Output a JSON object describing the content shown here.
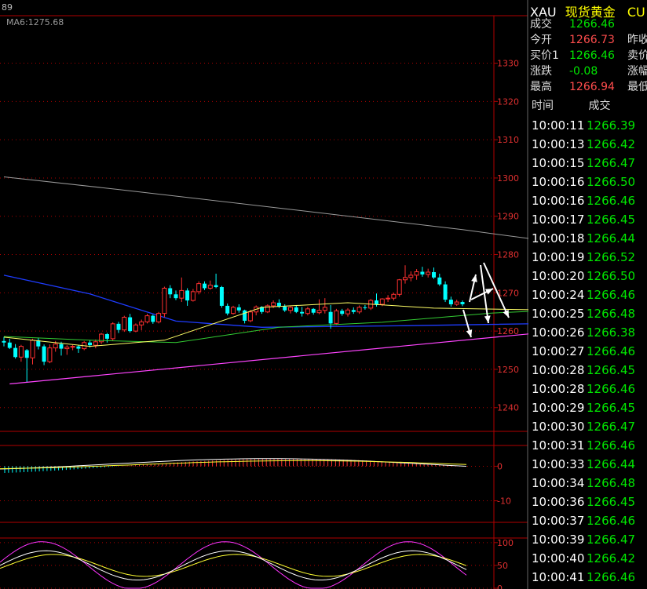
{
  "header": {
    "left_label": "89",
    "ma_label": "MA6:1275.68"
  },
  "colors": {
    "up": "#ff3030",
    "down": "#00ffff",
    "axis": "#b00000",
    "ma_gray": "#9a9a9a",
    "ma_yellow": "#ffff66",
    "ma_green": "#33cc33",
    "ma_blue": "#1e3cff",
    "trend_magenta": "#ff44ff",
    "arrow": "#ffffff"
  },
  "chart_data": [
    {
      "type": "candlestick",
      "yaxis": {
        "ticks": [
          "1330",
          "1320",
          "1310",
          "1300",
          "1290",
          "1280",
          "1270",
          "1260",
          "1250",
          "1240"
        ],
        "tick_values": [
          1330,
          1320,
          1310,
          1300,
          1290,
          1280,
          1270,
          1260,
          1250,
          1240
        ],
        "ylim": [
          1234,
          1342
        ]
      },
      "candles": [
        [
          1257.4,
          1258.5,
          1256.0,
          1257.0
        ],
        [
          1257.0,
          1258.0,
          1255.3,
          1255.6
        ],
        [
          1255.6,
          1256.6,
          1252.8,
          1253.2
        ],
        [
          1253.2,
          1256.4,
          1252.0,
          1256.0
        ],
        [
          1255.0,
          1255.3,
          1246.5,
          1253.0
        ],
        [
          1253.0,
          1258.0,
          1251.3,
          1257.6
        ],
        [
          1257.6,
          1258.3,
          1255.2,
          1256.0
        ],
        [
          1256.0,
          1256.5,
          1251.1,
          1252.0
        ],
        [
          1252.0,
          1256.5,
          1251.6,
          1255.6
        ],
        [
          1255.6,
          1257.4,
          1254.6,
          1256.6
        ],
        [
          1256.6,
          1257.2,
          1253.6,
          1255.4
        ],
        [
          1255.4,
          1256.3,
          1253.8,
          1255.8
        ],
        [
          1255.8,
          1256.4,
          1255.0,
          1256.0
        ],
        [
          1256.0,
          1256.4,
          1254.3,
          1255.4
        ],
        [
          1255.4,
          1257.4,
          1255.0,
          1257.0
        ],
        [
          1257.0,
          1257.6,
          1255.7,
          1256.3
        ],
        [
          1256.3,
          1257.8,
          1255.5,
          1257.2
        ],
        [
          1257.2,
          1259.5,
          1256.6,
          1259.2
        ],
        [
          1259.2,
          1259.5,
          1257.0,
          1258.0
        ],
        [
          1258.0,
          1262.3,
          1257.5,
          1261.9
        ],
        [
          1261.9,
          1262.4,
          1259.5,
          1260.3
        ],
        [
          1260.3,
          1264.0,
          1259.8,
          1263.6
        ],
        [
          1263.6,
          1264.5,
          1259.6,
          1260.0
        ],
        [
          1260.0,
          1262.0,
          1259.7,
          1261.6
        ],
        [
          1261.6,
          1263.0,
          1260.2,
          1262.4
        ],
        [
          1262.4,
          1264.5,
          1262.0,
          1264.0
        ],
        [
          1264.0,
          1264.3,
          1261.9,
          1262.4
        ],
        [
          1262.4,
          1265.0,
          1262.0,
          1264.6
        ],
        [
          1264.6,
          1271.6,
          1263.6,
          1271.2
        ],
        [
          1271.2,
          1272.0,
          1268.6,
          1269.6
        ],
        [
          1269.6,
          1270.6,
          1268.1,
          1268.6
        ],
        [
          1268.6,
          1274.0,
          1267.6,
          1270.6
        ],
        [
          1270.6,
          1271.2,
          1266.6,
          1268.0
        ],
        [
          1268.0,
          1271.0,
          1267.7,
          1270.3
        ],
        [
          1270.3,
          1273.0,
          1269.6,
          1272.4
        ],
        [
          1272.4,
          1273.0,
          1270.7,
          1271.2
        ],
        [
          1271.2,
          1273.2,
          1270.8,
          1272.0
        ],
        [
          1272.0,
          1275.0,
          1271.2,
          1271.5
        ],
        [
          1271.5,
          1271.8,
          1266.1,
          1266.6
        ],
        [
          1266.6,
          1267.2,
          1264.1,
          1264.6
        ],
        [
          1264.6,
          1266.6,
          1264.3,
          1266.2
        ],
        [
          1266.2,
          1267.0,
          1264.8,
          1265.4
        ],
        [
          1265.4,
          1265.6,
          1262.0,
          1262.7
        ],
        [
          1262.7,
          1265.5,
          1262.3,
          1265.0
        ],
        [
          1265.0,
          1266.7,
          1264.1,
          1266.3
        ],
        [
          1266.3,
          1266.5,
          1264.5,
          1265.0
        ],
        [
          1265.0,
          1267.0,
          1264.7,
          1266.6
        ],
        [
          1266.6,
          1268.0,
          1266.0,
          1267.4
        ],
        [
          1267.4,
          1268.3,
          1266.0,
          1266.4
        ],
        [
          1266.4,
          1267.0,
          1265.0,
          1265.4
        ],
        [
          1265.4,
          1266.5,
          1264.6,
          1266.2
        ],
        [
          1266.2,
          1266.8,
          1264.7,
          1265.0
        ],
        [
          1265.0,
          1266.3,
          1263.8,
          1264.6
        ],
        [
          1264.6,
          1266.3,
          1264.1,
          1265.8
        ],
        [
          1265.8,
          1266.0,
          1264.3,
          1264.8
        ],
        [
          1264.8,
          1268.3,
          1264.4,
          1265.4
        ],
        [
          1265.4,
          1268.6,
          1264.6,
          1266.2
        ],
        [
          1265.0,
          1266.8,
          1260.6,
          1262.0
        ],
        [
          1262.0,
          1265.8,
          1261.6,
          1265.3
        ],
        [
          1265.3,
          1265.8,
          1264.0,
          1264.5
        ],
        [
          1264.5,
          1266.0,
          1263.8,
          1265.5
        ],
        [
          1265.5,
          1266.2,
          1264.5,
          1265.0
        ],
        [
          1265.0,
          1266.7,
          1264.5,
          1266.2
        ],
        [
          1266.2,
          1266.8,
          1265.6,
          1266.0
        ],
        [
          1266.0,
          1268.4,
          1265.5,
          1268.0
        ],
        [
          1268.0,
          1269.8,
          1266.4,
          1267.0
        ],
        [
          1267.0,
          1268.6,
          1266.5,
          1268.4
        ],
        [
          1268.4,
          1269.4,
          1267.6,
          1268.6
        ],
        [
          1268.6,
          1270.0,
          1268.0,
          1269.6
        ],
        [
          1269.6,
          1273.6,
          1269.0,
          1273.4
        ],
        [
          1273.4,
          1277.2,
          1272.4,
          1274.0
        ],
        [
          1274.0,
          1275.6,
          1273.0,
          1274.6
        ],
        [
          1274.6,
          1276.2,
          1273.4,
          1275.5
        ],
        [
          1275.5,
          1276.8,
          1274.2,
          1274.8
        ],
        [
          1274.8,
          1276.3,
          1274.0,
          1275.4
        ],
        [
          1275.4,
          1276.6,
          1273.6,
          1274.0
        ],
        [
          1274.0,
          1275.0,
          1271.8,
          1272.2
        ],
        [
          1272.2,
          1273.0,
          1267.6,
          1268.2
        ],
        [
          1268.2,
          1269.0,
          1266.4,
          1267.0
        ],
        [
          1267.0,
          1268.2,
          1266.6,
          1267.6
        ],
        [
          1267.6,
          1268.0,
          1266.5,
          1267.0
        ]
      ],
      "ma_gray": [
        [
          0,
          1300.3
        ],
        [
          20,
          1297.0
        ],
        [
          50,
          1291.8
        ],
        [
          80,
          1286.5
        ],
        [
          110,
          1280.5
        ],
        [
          125,
          1276.0
        ],
        [
          140,
          1273.4
        ],
        [
          148,
          1272.4
        ]
      ],
      "ma_blue": [
        [
          0,
          1274.6
        ],
        [
          15,
          1269.7
        ],
        [
          30,
          1262.6
        ],
        [
          45,
          1261.0
        ],
        [
          70,
          1261.4
        ],
        [
          100,
          1262.1
        ],
        [
          125,
          1262.3
        ],
        [
          140,
          1263.1
        ],
        [
          150,
          1263.8
        ]
      ],
      "ma_yellow": [
        [
          0,
          1258.4
        ],
        [
          15,
          1256.0
        ],
        [
          28,
          1257.6
        ],
        [
          45,
          1266.2
        ],
        [
          60,
          1267.4
        ],
        [
          75,
          1266.0
        ],
        [
          100,
          1265.4
        ],
        [
          118,
          1266.6
        ],
        [
          132,
          1273.4
        ],
        [
          142,
          1271.6
        ],
        [
          150,
          1269.8
        ]
      ],
      "ma_green": [
        [
          0,
          1258.6
        ],
        [
          15,
          1257.6
        ],
        [
          30,
          1257.0
        ],
        [
          48,
          1261.0
        ],
        [
          66,
          1262.3
        ],
        [
          85,
          1264.7
        ],
        [
          105,
          1266.0
        ],
        [
          125,
          1266.8
        ],
        [
          140,
          1268.0
        ],
        [
          150,
          1267.4
        ]
      ],
      "trend": [
        [
          1,
          1246.2
        ],
        [
          155,
          1268.4
        ]
      ]
    },
    {
      "type": "bar",
      "name": "macd",
      "yaxis": {
        "ticks": [
          "0",
          "-10"
        ],
        "tick_values": [
          0,
          -10
        ],
        "ylim": [
          -16,
          6
        ]
      }
    },
    {
      "type": "line",
      "name": "kdj",
      "yaxis": {
        "ticks": [
          "100",
          "50",
          "0"
        ],
        "tick_values": [
          100,
          50,
          0
        ],
        "ylim": [
          0,
          110
        ]
      }
    }
  ],
  "quote": {
    "code": "XAU",
    "name": "现货黄金",
    "suffix": "CU",
    "rows": [
      {
        "label": "成交",
        "value": "1266.46",
        "color": "green",
        "extra": ""
      },
      {
        "label": "今开",
        "value": "1266.73",
        "color": "red",
        "extra": "昨收"
      },
      {
        "label": "买价1",
        "value": "1266.46",
        "color": "green",
        "extra": "卖价"
      },
      {
        "label": "涨跌",
        "value": "-0.08",
        "color": "green",
        "extra": "涨幅"
      },
      {
        "label": "最高",
        "value": "1266.94",
        "color": "red",
        "extra": "最低"
      }
    ]
  },
  "trades_header": {
    "time": "时间",
    "price": "成交"
  },
  "trades": [
    {
      "t": "10:00:11",
      "p": "1266.39"
    },
    {
      "t": "10:00:13",
      "p": "1266.42"
    },
    {
      "t": "10:00:15",
      "p": "1266.47"
    },
    {
      "t": "10:00:16",
      "p": "1266.50"
    },
    {
      "t": "10:00:16",
      "p": "1266.46"
    },
    {
      "t": "10:00:17",
      "p": "1266.45"
    },
    {
      "t": "10:00:18",
      "p": "1266.44"
    },
    {
      "t": "10:00:19",
      "p": "1266.52"
    },
    {
      "t": "10:00:20",
      "p": "1266.50"
    },
    {
      "t": "10:00:24",
      "p": "1266.46"
    },
    {
      "t": "10:00:25",
      "p": "1266.48"
    },
    {
      "t": "10:00:26",
      "p": "1266.38"
    },
    {
      "t": "10:00:27",
      "p": "1266.46"
    },
    {
      "t": "10:00:28",
      "p": "1266.45"
    },
    {
      "t": "10:00:28",
      "p": "1266.46"
    },
    {
      "t": "10:00:29",
      "p": "1266.45"
    },
    {
      "t": "10:00:30",
      "p": "1266.47"
    },
    {
      "t": "10:00:31",
      "p": "1266.46"
    },
    {
      "t": "10:00:33",
      "p": "1266.44"
    },
    {
      "t": "10:00:34",
      "p": "1266.48"
    },
    {
      "t": "10:00:36",
      "p": "1266.45"
    },
    {
      "t": "10:00:37",
      "p": "1266.46"
    },
    {
      "t": "10:00:39",
      "p": "1266.47"
    },
    {
      "t": "10:00:40",
      "p": "1266.42"
    },
    {
      "t": "10:00:41",
      "p": "1266.46"
    }
  ]
}
